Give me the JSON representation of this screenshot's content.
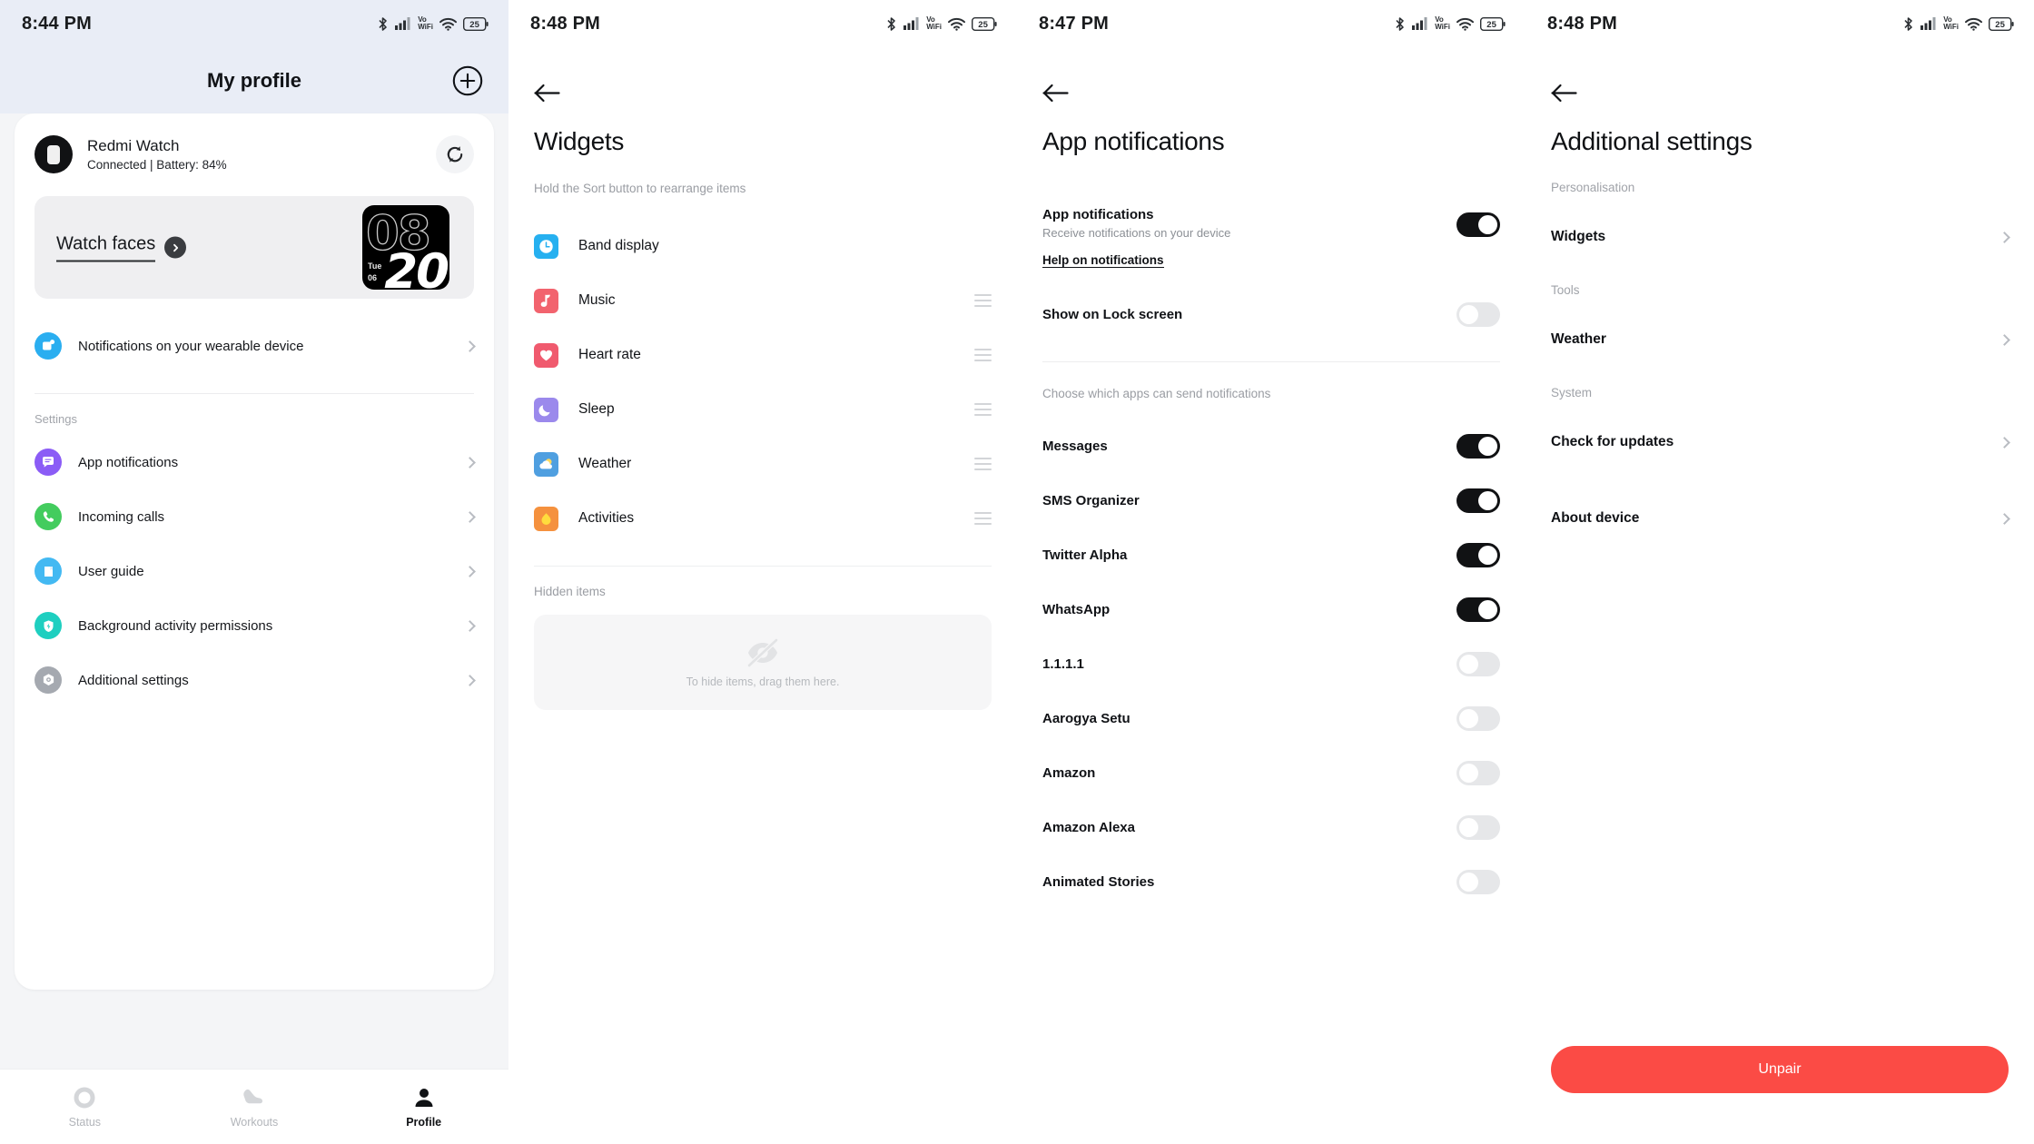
{
  "statusbar": {
    "time_p1": "8:44 PM",
    "time_p2": "8:48 PM",
    "time_p3": "8:47 PM",
    "time_p4": "8:48 PM",
    "vowifi_top": "Vo",
    "vowifi_bottom": "WiFi",
    "battery": "25"
  },
  "profile": {
    "title": "My profile",
    "add_label": "+",
    "device": {
      "name": "Redmi Watch",
      "status": "Connected | Battery: 84%"
    },
    "watch_faces": {
      "label": "Watch faces",
      "preview_hour": "08",
      "preview_minute": "20",
      "preview_day": "Tue",
      "preview_date": "06"
    },
    "notifications_item": "Notifications on your wearable device",
    "settings_header": "Settings",
    "settings_items": [
      {
        "label": "App notifications",
        "color": "#8b5cf6",
        "icon": "chat-bubble-icon"
      },
      {
        "label": "Incoming calls",
        "color": "#43cc5e",
        "icon": "phone-icon"
      },
      {
        "label": "User guide",
        "color": "#43b9f2",
        "icon": "book-icon"
      },
      {
        "label": "Background activity permissions",
        "color": "#1ecfc0",
        "icon": "shield-bolt-icon"
      },
      {
        "label": "Additional settings",
        "color": "#a5a9b0",
        "icon": "gear-icon"
      }
    ],
    "tabs": [
      {
        "label": "Status",
        "icon": "ring-icon",
        "active": false
      },
      {
        "label": "Workouts",
        "icon": "shoe-icon",
        "active": false
      },
      {
        "label": "Profile",
        "icon": "person-icon",
        "active": true
      }
    ]
  },
  "widgets": {
    "title": "Widgets",
    "hint": "Hold the Sort button to rearrange items",
    "items": [
      {
        "label": "Band display",
        "color": "#26b0f0",
        "icon": "clock-icon",
        "sortable": false
      },
      {
        "label": "Music",
        "color": "#f2636e",
        "icon": "music-note-icon",
        "sortable": true
      },
      {
        "label": "Heart rate",
        "color": "#f05a6e",
        "icon": "heart-icon",
        "sortable": true
      },
      {
        "label": "Sleep",
        "color": "#9b89ec",
        "icon": "moon-icon",
        "sortable": true
      },
      {
        "label": "Weather",
        "color": "#4f9fe0",
        "icon": "sun-cloud-icon",
        "sortable": true
      },
      {
        "label": "Activities",
        "color": "#f5913e",
        "icon": "flame-icon",
        "sortable": true
      }
    ],
    "hidden_title": "Hidden items",
    "drop_text": "To hide items, drag them here."
  },
  "app_notifications": {
    "title": "App notifications",
    "master": {
      "title": "App notifications",
      "subtitle": "Receive notifications on your device",
      "on": true
    },
    "help_link": "Help on notifications",
    "lock_screen": {
      "title": "Show on Lock screen",
      "on": false
    },
    "choose_hint": "Choose which apps can send notifications",
    "apps": [
      {
        "name": "Messages",
        "on": true
      },
      {
        "name": "SMS Organizer",
        "on": true
      },
      {
        "name": "Twitter Alpha",
        "on": true
      },
      {
        "name": "WhatsApp",
        "on": true
      },
      {
        "name": "1.1.1.1",
        "on": false
      },
      {
        "name": "Aarogya Setu",
        "on": false
      },
      {
        "name": "Amazon",
        "on": false
      },
      {
        "name": "Amazon Alexa",
        "on": false
      },
      {
        "name": "Animated Stories",
        "on": false
      }
    ]
  },
  "additional_settings": {
    "title": "Additional settings",
    "groups": [
      {
        "header": "Personalisation",
        "items": [
          "Widgets"
        ]
      },
      {
        "header": "Tools",
        "items": [
          "Weather"
        ]
      },
      {
        "header": "System",
        "items": [
          "Check for updates",
          "About device"
        ]
      }
    ],
    "unpair_label": "Unpair",
    "unpair_color": "#fb4b45"
  }
}
